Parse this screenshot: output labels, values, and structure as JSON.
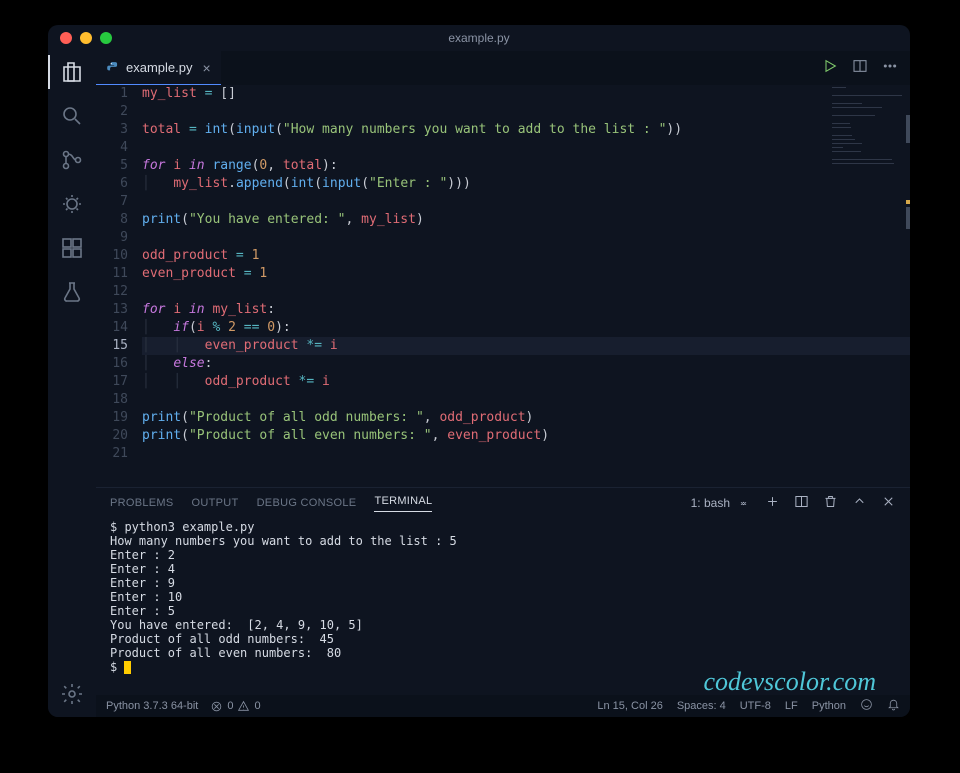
{
  "window": {
    "title": "example.py"
  },
  "tab": {
    "filename": "example.py"
  },
  "code": {
    "lines": [
      {
        "n": 1,
        "tokens": [
          [
            "v",
            "my_list"
          ],
          [
            "p",
            " "
          ],
          [
            "o",
            "="
          ],
          [
            "p",
            " []"
          ]
        ]
      },
      {
        "n": 2,
        "tokens": []
      },
      {
        "n": 3,
        "tokens": [
          [
            "v",
            "total"
          ],
          [
            "p",
            " "
          ],
          [
            "o",
            "="
          ],
          [
            "p",
            " "
          ],
          [
            "f",
            "int"
          ],
          [
            "p",
            "("
          ],
          [
            "f",
            "input"
          ],
          [
            "p",
            "("
          ],
          [
            "s",
            "\"How many numbers you want to add to the list : \""
          ],
          [
            "p",
            "))"
          ]
        ]
      },
      {
        "n": 4,
        "tokens": []
      },
      {
        "n": 5,
        "tokens": [
          [
            "k",
            "for"
          ],
          [
            "p",
            " "
          ],
          [
            "v",
            "i"
          ],
          [
            "p",
            " "
          ],
          [
            "k",
            "in"
          ],
          [
            "p",
            " "
          ],
          [
            "f",
            "range"
          ],
          [
            "p",
            "("
          ],
          [
            "n",
            "0"
          ],
          [
            "p",
            ", "
          ],
          [
            "v",
            "total"
          ],
          [
            "p",
            "):"
          ]
        ]
      },
      {
        "n": 6,
        "tokens": [
          [
            "guide",
            "│   "
          ],
          [
            "v",
            "my_list"
          ],
          [
            "p",
            "."
          ],
          [
            "f",
            "append"
          ],
          [
            "p",
            "("
          ],
          [
            "f",
            "int"
          ],
          [
            "p",
            "("
          ],
          [
            "f",
            "input"
          ],
          [
            "p",
            "("
          ],
          [
            "s",
            "\"Enter : \""
          ],
          [
            "p",
            ")))"
          ]
        ]
      },
      {
        "n": 7,
        "tokens": []
      },
      {
        "n": 8,
        "tokens": [
          [
            "f",
            "print"
          ],
          [
            "p",
            "("
          ],
          [
            "s",
            "\"You have entered: \""
          ],
          [
            "p",
            ", "
          ],
          [
            "v",
            "my_list"
          ],
          [
            "p",
            ")"
          ]
        ]
      },
      {
        "n": 9,
        "tokens": []
      },
      {
        "n": 10,
        "tokens": [
          [
            "v",
            "odd_product"
          ],
          [
            "p",
            " "
          ],
          [
            "o",
            "="
          ],
          [
            "p",
            " "
          ],
          [
            "n",
            "1"
          ]
        ]
      },
      {
        "n": 11,
        "tokens": [
          [
            "v",
            "even_product"
          ],
          [
            "p",
            " "
          ],
          [
            "o",
            "="
          ],
          [
            "p",
            " "
          ],
          [
            "n",
            "1"
          ]
        ]
      },
      {
        "n": 12,
        "tokens": []
      },
      {
        "n": 13,
        "tokens": [
          [
            "k",
            "for"
          ],
          [
            "p",
            " "
          ],
          [
            "v",
            "i"
          ],
          [
            "p",
            " "
          ],
          [
            "k",
            "in"
          ],
          [
            "p",
            " "
          ],
          [
            "v",
            "my_list"
          ],
          [
            "p",
            ":"
          ]
        ]
      },
      {
        "n": 14,
        "tokens": [
          [
            "guide",
            "│   "
          ],
          [
            "k",
            "if"
          ],
          [
            "p",
            "("
          ],
          [
            "v",
            "i"
          ],
          [
            "p",
            " "
          ],
          [
            "o",
            "%"
          ],
          [
            "p",
            " "
          ],
          [
            "n",
            "2"
          ],
          [
            "p",
            " "
          ],
          [
            "o",
            "=="
          ],
          [
            "p",
            " "
          ],
          [
            "n",
            "0"
          ],
          [
            "p",
            "):"
          ]
        ]
      },
      {
        "n": 15,
        "cur": true,
        "tokens": [
          [
            "guide",
            "│   │   "
          ],
          [
            "v",
            "even_product"
          ],
          [
            "p",
            " "
          ],
          [
            "o",
            "*="
          ],
          [
            "p",
            " "
          ],
          [
            "v",
            "i"
          ]
        ]
      },
      {
        "n": 16,
        "tokens": [
          [
            "guide",
            "│   "
          ],
          [
            "k",
            "else"
          ],
          [
            "p",
            ":"
          ]
        ]
      },
      {
        "n": 17,
        "tokens": [
          [
            "guide",
            "│   │   "
          ],
          [
            "v",
            "odd_product"
          ],
          [
            "p",
            " "
          ],
          [
            "o",
            "*="
          ],
          [
            "p",
            " "
          ],
          [
            "v",
            "i"
          ]
        ]
      },
      {
        "n": 18,
        "tokens": []
      },
      {
        "n": 19,
        "tokens": [
          [
            "f",
            "print"
          ],
          [
            "p",
            "("
          ],
          [
            "s",
            "\"Product of all odd numbers: \""
          ],
          [
            "p",
            ", "
          ],
          [
            "v",
            "odd_product"
          ],
          [
            "p",
            ")"
          ]
        ]
      },
      {
        "n": 20,
        "tokens": [
          [
            "f",
            "print"
          ],
          [
            "p",
            "("
          ],
          [
            "s",
            "\"Product of all even numbers: \""
          ],
          [
            "p",
            ", "
          ],
          [
            "v",
            "even_product"
          ],
          [
            "p",
            ")"
          ]
        ]
      },
      {
        "n": 21,
        "tokens": []
      }
    ]
  },
  "panel": {
    "tabs": [
      "PROBLEMS",
      "OUTPUT",
      "DEBUG CONSOLE",
      "TERMINAL"
    ],
    "active": "TERMINAL",
    "shell": "1: bash",
    "terminal_lines": [
      "$ python3 example.py",
      "How many numbers you want to add to the list : 5",
      "Enter : 2",
      "Enter : 4",
      "Enter : 9",
      "Enter : 10",
      "Enter : 5",
      "You have entered:  [2, 4, 9, 10, 5]",
      "Product of all odd numbers:  45",
      "Product of all even numbers:  80"
    ],
    "prompt": "$ "
  },
  "status": {
    "interpreter": "Python 3.7.3 64-bit",
    "errors": "0",
    "warnings": "0",
    "cursor": "Ln 15, Col 26",
    "spaces": "Spaces: 4",
    "encoding": "UTF-8",
    "eol": "LF",
    "lang": "Python"
  },
  "watermark": "codevscolor.com"
}
